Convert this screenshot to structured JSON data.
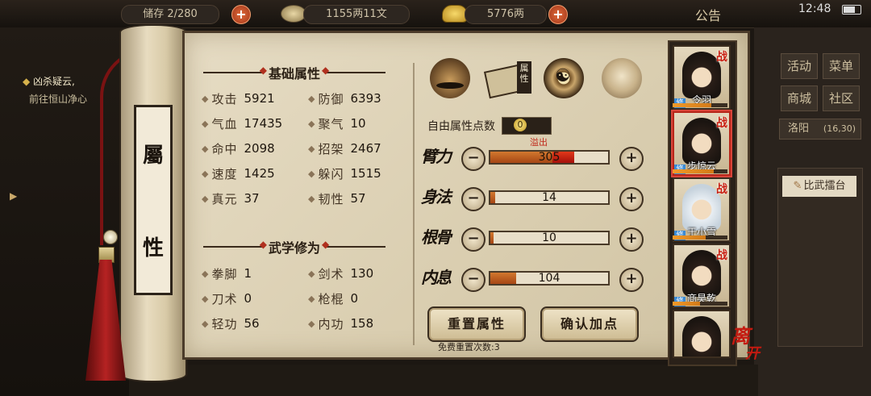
{
  "topbar": {
    "capacity_label": "储存",
    "capacity_value": "2/280",
    "copper_value": "1155两11文",
    "gold_value": "5776两",
    "notice_label": "公告",
    "time": "12:48",
    "plus_symbol": "+"
  },
  "quest": {
    "title": "凶杀疑云,",
    "subtitle": "前往恒山净心"
  },
  "scroll": {
    "label_char1": "屬",
    "label_char2": "性"
  },
  "basic": {
    "title": "基础属性",
    "stats": [
      {
        "label": "攻击",
        "value": "5921"
      },
      {
        "label": "防御",
        "value": "6393"
      },
      {
        "label": "气血",
        "value": "17435"
      },
      {
        "label": "聚气",
        "value": "10"
      },
      {
        "label": "命中",
        "value": "2098"
      },
      {
        "label": "招架",
        "value": "2467"
      },
      {
        "label": "速度",
        "value": "1425"
      },
      {
        "label": "躲闪",
        "value": "1515"
      },
      {
        "label": "真元",
        "value": "37"
      },
      {
        "label": "韧性",
        "value": "57"
      }
    ]
  },
  "martial": {
    "title": "武学修为",
    "stats": [
      {
        "label": "拳脚",
        "value": "1"
      },
      {
        "label": "剑术",
        "value": "130"
      },
      {
        "label": "刀术",
        "value": "0"
      },
      {
        "label": "枪棍",
        "value": "0"
      },
      {
        "label": "轻功",
        "value": "56"
      },
      {
        "label": "内功",
        "value": "158"
      }
    ]
  },
  "tabs": {
    "attr_badge": "属性",
    "icons": [
      "hat-icon",
      "attribute-scroll-icon",
      "bagua-icon",
      "meridian-body-icon"
    ]
  },
  "free_points": {
    "label": "自由属性点数",
    "value": "0"
  },
  "attributes": [
    {
      "name": "臂力",
      "value": "305",
      "fill": 0.55,
      "over": 0.18
    },
    {
      "name": "身法",
      "value": "14",
      "fill": 0.04,
      "over": 0
    },
    {
      "name": "根骨",
      "value": "10",
      "fill": 0.03,
      "over": 0
    },
    {
      "name": "内息",
      "value": "104",
      "fill": 0.22,
      "over": 0
    }
  ],
  "overflow_tag": "溢出",
  "minus_symbol": "−",
  "plus_symbol": "+",
  "actions": {
    "reset_label": "重置属性",
    "confirm_label": "确认加点",
    "reset_count": "免费重置次数:3"
  },
  "characters": [
    {
      "name": "令羽",
      "tag": "战",
      "badge": "修",
      "progress": 0.7
    },
    {
      "name": "步惊云",
      "tag": "战",
      "badge": "修",
      "progress": 0.75
    },
    {
      "name": "于小雪",
      "tag": "战",
      "badge": "修",
      "progress": 0.6
    },
    {
      "name": "商昊乾",
      "tag": "战",
      "badge": "修",
      "progress": 0.5
    },
    {
      "name": "",
      "tag": "",
      "badge": "",
      "progress": 0
    }
  ],
  "leave": {
    "char1": "离",
    "char2": "开"
  },
  "right_menu": {
    "activity": "活动",
    "menu": "菜单",
    "shop": "商城",
    "community": "社区",
    "location": "洛阳",
    "coords": "(16,30)",
    "arena": "比武擂台"
  },
  "colors": {
    "accent_red": "#c41a10",
    "bar_orange": "#d2782f",
    "bar_overflow": "#e2381a",
    "paper": "#e6dcc4"
  }
}
